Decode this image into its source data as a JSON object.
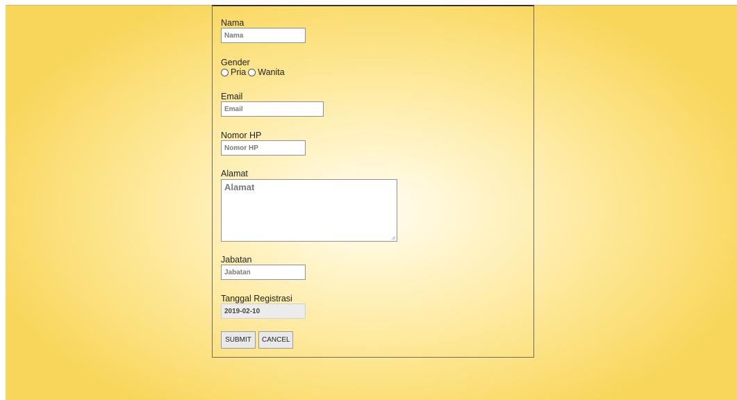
{
  "form": {
    "nama": {
      "label": "Nama",
      "placeholder": "Nama"
    },
    "gender": {
      "label": "Gender",
      "options": [
        "Pria",
        "Wanita"
      ]
    },
    "email": {
      "label": "Email",
      "placeholder": "Email"
    },
    "nomor_hp": {
      "label": "Nomor HP",
      "placeholder": "Nomor HP"
    },
    "alamat": {
      "label": "Alamat",
      "placeholder": "Alamat"
    },
    "jabatan": {
      "label": "Jabatan",
      "placeholder": "Jabatan"
    },
    "tanggal_registrasi": {
      "label": "Tanggal Registrasi",
      "value": "2019-02-10"
    },
    "buttons": {
      "submit": "SUBMIT",
      "cancel": "CANCEL"
    }
  },
  "colors": {
    "background_center": "#fffdf4",
    "background_edge": "#f8d65a",
    "border": "#6a6a6a",
    "button_bg": "#e9e9e9"
  }
}
